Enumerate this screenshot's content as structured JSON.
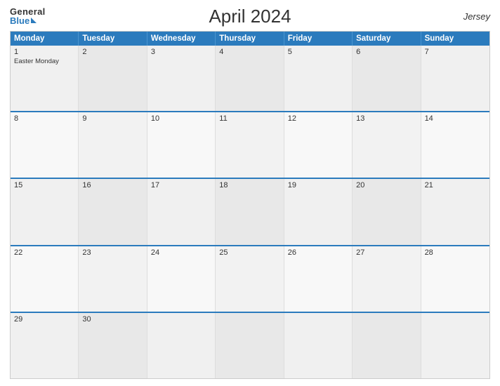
{
  "header": {
    "logo_general": "General",
    "logo_blue": "Blue",
    "title": "April 2024",
    "region": "Jersey"
  },
  "calendar": {
    "days_of_week": [
      "Monday",
      "Tuesday",
      "Wednesday",
      "Thursday",
      "Friday",
      "Saturday",
      "Sunday"
    ],
    "weeks": [
      [
        {
          "day": "1",
          "event": "Easter Monday"
        },
        {
          "day": "2",
          "event": ""
        },
        {
          "day": "3",
          "event": ""
        },
        {
          "day": "4",
          "event": ""
        },
        {
          "day": "5",
          "event": ""
        },
        {
          "day": "6",
          "event": ""
        },
        {
          "day": "7",
          "event": ""
        }
      ],
      [
        {
          "day": "8",
          "event": ""
        },
        {
          "day": "9",
          "event": ""
        },
        {
          "day": "10",
          "event": ""
        },
        {
          "day": "11",
          "event": ""
        },
        {
          "day": "12",
          "event": ""
        },
        {
          "day": "13",
          "event": ""
        },
        {
          "day": "14",
          "event": ""
        }
      ],
      [
        {
          "day": "15",
          "event": ""
        },
        {
          "day": "16",
          "event": ""
        },
        {
          "day": "17",
          "event": ""
        },
        {
          "day": "18",
          "event": ""
        },
        {
          "day": "19",
          "event": ""
        },
        {
          "day": "20",
          "event": ""
        },
        {
          "day": "21",
          "event": ""
        }
      ],
      [
        {
          "day": "22",
          "event": ""
        },
        {
          "day": "23",
          "event": ""
        },
        {
          "day": "24",
          "event": ""
        },
        {
          "day": "25",
          "event": ""
        },
        {
          "day": "26",
          "event": ""
        },
        {
          "day": "27",
          "event": ""
        },
        {
          "day": "28",
          "event": ""
        }
      ],
      [
        {
          "day": "29",
          "event": ""
        },
        {
          "day": "30",
          "event": ""
        },
        {
          "day": "",
          "event": ""
        },
        {
          "day": "",
          "event": ""
        },
        {
          "day": "",
          "event": ""
        },
        {
          "day": "",
          "event": ""
        },
        {
          "day": "",
          "event": ""
        }
      ]
    ]
  }
}
